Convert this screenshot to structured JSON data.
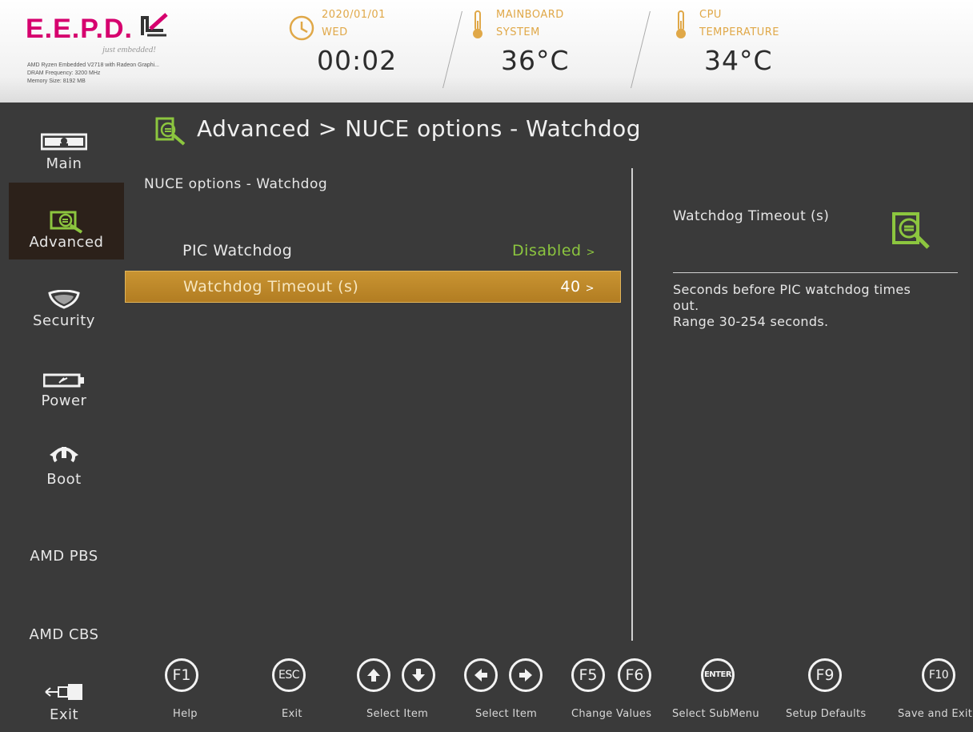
{
  "header": {
    "logo_text": "E.E.P.D.",
    "tagline": "just embedded!",
    "sysinfo": [
      "AMD Ryzen Embedded V2718 with Radeon Graphi...",
      "DRAM Frequency: 3200 MHz",
      "Memory Size: 8192 MB"
    ],
    "date": "2020/01/01",
    "weekday": "WED",
    "time": "00:02",
    "mainboard_label_1": "MAINBOARD",
    "mainboard_label_2": "SYSTEM",
    "mainboard_temp": "36°C",
    "cpu_label_1": "CPU",
    "cpu_label_2": "TEMPERATURE",
    "cpu_temp": "34°C"
  },
  "sidebar": {
    "items": [
      {
        "label": "Main",
        "icon": "monitor-icon"
      },
      {
        "label": "Advanced",
        "icon": "advanced-icon",
        "active": true
      },
      {
        "label": "Security",
        "icon": "shield-icon"
      },
      {
        "label": "Power",
        "icon": "battery-icon"
      },
      {
        "label": "Boot",
        "icon": "power-boot-icon"
      },
      {
        "label": "AMD PBS"
      },
      {
        "label": "AMD CBS"
      },
      {
        "label": "Exit",
        "icon": "exit-plug-icon"
      }
    ]
  },
  "breadcrumb": {
    "text": "Advanced > NUCE options - Watchdog",
    "icon": "advanced-icon"
  },
  "main": {
    "section_title": "NUCE options - Watchdog",
    "options": [
      {
        "label": "PIC Watchdog",
        "value": "Disabled",
        "arrow": ">"
      },
      {
        "label": "Watchdog Timeout (s)",
        "value": "40",
        "arrow": ">",
        "selected": true
      }
    ]
  },
  "help": {
    "title": "Watchdog Timeout (s)",
    "lines": [
      "Seconds before PIC watchdog times",
      "out.",
      "Range 30-254 seconds."
    ]
  },
  "footer": {
    "keys": [
      {
        "keys": [
          "F1"
        ],
        "caption": "Help"
      },
      {
        "keys": [
          "ESC"
        ],
        "caption": "Exit"
      },
      {
        "keys": [
          "up-arrow-icon",
          "down-arrow-icon"
        ],
        "caption": "Select Item"
      },
      {
        "keys": [
          "left-arrow-icon",
          "right-arrow-icon"
        ],
        "caption": "Select Item"
      },
      {
        "keys": [
          "F5",
          "F6"
        ],
        "caption": "Change Values"
      },
      {
        "keys": [
          "ENTER"
        ],
        "caption": "Select  SubMenu"
      },
      {
        "keys": [
          "F9"
        ],
        "caption": "Setup Defaults"
      },
      {
        "keys": [
          "F10"
        ],
        "caption": "Save and Exit"
      }
    ]
  },
  "colors": {
    "accent_green": "#8cc63f",
    "selection_gold": "#c18a2c",
    "header_orange": "#e0a848",
    "brand_magenta": "#d6006e",
    "background": "#3a3a3a"
  }
}
